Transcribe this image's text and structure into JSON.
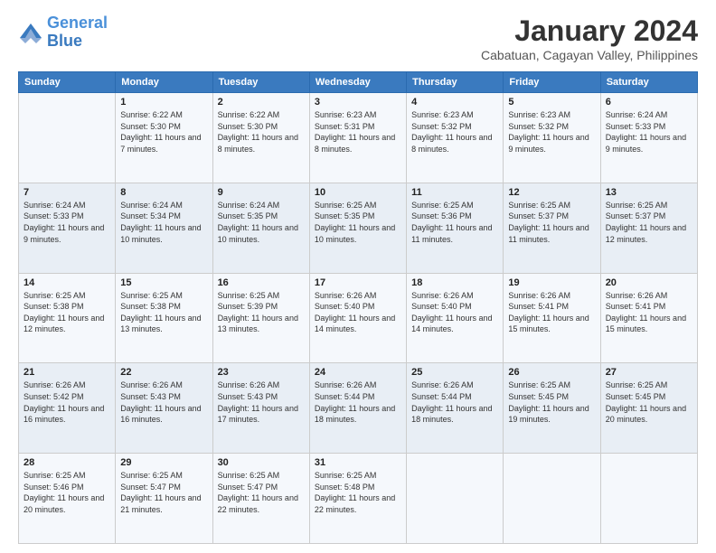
{
  "logo": {
    "line1": "General",
    "line2": "Blue"
  },
  "title": "January 2024",
  "subtitle": "Cabatuan, Cagayan Valley, Philippines",
  "days_of_week": [
    "Sunday",
    "Monday",
    "Tuesday",
    "Wednesday",
    "Thursday",
    "Friday",
    "Saturday"
  ],
  "weeks": [
    [
      {
        "num": "",
        "sunrise": "",
        "sunset": "",
        "daylight": ""
      },
      {
        "num": "1",
        "sunrise": "Sunrise: 6:22 AM",
        "sunset": "Sunset: 5:30 PM",
        "daylight": "Daylight: 11 hours and 7 minutes."
      },
      {
        "num": "2",
        "sunrise": "Sunrise: 6:22 AM",
        "sunset": "Sunset: 5:30 PM",
        "daylight": "Daylight: 11 hours and 8 minutes."
      },
      {
        "num": "3",
        "sunrise": "Sunrise: 6:23 AM",
        "sunset": "Sunset: 5:31 PM",
        "daylight": "Daylight: 11 hours and 8 minutes."
      },
      {
        "num": "4",
        "sunrise": "Sunrise: 6:23 AM",
        "sunset": "Sunset: 5:32 PM",
        "daylight": "Daylight: 11 hours and 8 minutes."
      },
      {
        "num": "5",
        "sunrise": "Sunrise: 6:23 AM",
        "sunset": "Sunset: 5:32 PM",
        "daylight": "Daylight: 11 hours and 9 minutes."
      },
      {
        "num": "6",
        "sunrise": "Sunrise: 6:24 AM",
        "sunset": "Sunset: 5:33 PM",
        "daylight": "Daylight: 11 hours and 9 minutes."
      }
    ],
    [
      {
        "num": "7",
        "sunrise": "Sunrise: 6:24 AM",
        "sunset": "Sunset: 5:33 PM",
        "daylight": "Daylight: 11 hours and 9 minutes."
      },
      {
        "num": "8",
        "sunrise": "Sunrise: 6:24 AM",
        "sunset": "Sunset: 5:34 PM",
        "daylight": "Daylight: 11 hours and 10 minutes."
      },
      {
        "num": "9",
        "sunrise": "Sunrise: 6:24 AM",
        "sunset": "Sunset: 5:35 PM",
        "daylight": "Daylight: 11 hours and 10 minutes."
      },
      {
        "num": "10",
        "sunrise": "Sunrise: 6:25 AM",
        "sunset": "Sunset: 5:35 PM",
        "daylight": "Daylight: 11 hours and 10 minutes."
      },
      {
        "num": "11",
        "sunrise": "Sunrise: 6:25 AM",
        "sunset": "Sunset: 5:36 PM",
        "daylight": "Daylight: 11 hours and 11 minutes."
      },
      {
        "num": "12",
        "sunrise": "Sunrise: 6:25 AM",
        "sunset": "Sunset: 5:37 PM",
        "daylight": "Daylight: 11 hours and 11 minutes."
      },
      {
        "num": "13",
        "sunrise": "Sunrise: 6:25 AM",
        "sunset": "Sunset: 5:37 PM",
        "daylight": "Daylight: 11 hours and 12 minutes."
      }
    ],
    [
      {
        "num": "14",
        "sunrise": "Sunrise: 6:25 AM",
        "sunset": "Sunset: 5:38 PM",
        "daylight": "Daylight: 11 hours and 12 minutes."
      },
      {
        "num": "15",
        "sunrise": "Sunrise: 6:25 AM",
        "sunset": "Sunset: 5:38 PM",
        "daylight": "Daylight: 11 hours and 13 minutes."
      },
      {
        "num": "16",
        "sunrise": "Sunrise: 6:25 AM",
        "sunset": "Sunset: 5:39 PM",
        "daylight": "Daylight: 11 hours and 13 minutes."
      },
      {
        "num": "17",
        "sunrise": "Sunrise: 6:26 AM",
        "sunset": "Sunset: 5:40 PM",
        "daylight": "Daylight: 11 hours and 14 minutes."
      },
      {
        "num": "18",
        "sunrise": "Sunrise: 6:26 AM",
        "sunset": "Sunset: 5:40 PM",
        "daylight": "Daylight: 11 hours and 14 minutes."
      },
      {
        "num": "19",
        "sunrise": "Sunrise: 6:26 AM",
        "sunset": "Sunset: 5:41 PM",
        "daylight": "Daylight: 11 hours and 15 minutes."
      },
      {
        "num": "20",
        "sunrise": "Sunrise: 6:26 AM",
        "sunset": "Sunset: 5:41 PM",
        "daylight": "Daylight: 11 hours and 15 minutes."
      }
    ],
    [
      {
        "num": "21",
        "sunrise": "Sunrise: 6:26 AM",
        "sunset": "Sunset: 5:42 PM",
        "daylight": "Daylight: 11 hours and 16 minutes."
      },
      {
        "num": "22",
        "sunrise": "Sunrise: 6:26 AM",
        "sunset": "Sunset: 5:43 PM",
        "daylight": "Daylight: 11 hours and 16 minutes."
      },
      {
        "num": "23",
        "sunrise": "Sunrise: 6:26 AM",
        "sunset": "Sunset: 5:43 PM",
        "daylight": "Daylight: 11 hours and 17 minutes."
      },
      {
        "num": "24",
        "sunrise": "Sunrise: 6:26 AM",
        "sunset": "Sunset: 5:44 PM",
        "daylight": "Daylight: 11 hours and 18 minutes."
      },
      {
        "num": "25",
        "sunrise": "Sunrise: 6:26 AM",
        "sunset": "Sunset: 5:44 PM",
        "daylight": "Daylight: 11 hours and 18 minutes."
      },
      {
        "num": "26",
        "sunrise": "Sunrise: 6:25 AM",
        "sunset": "Sunset: 5:45 PM",
        "daylight": "Daylight: 11 hours and 19 minutes."
      },
      {
        "num": "27",
        "sunrise": "Sunrise: 6:25 AM",
        "sunset": "Sunset: 5:45 PM",
        "daylight": "Daylight: 11 hours and 20 minutes."
      }
    ],
    [
      {
        "num": "28",
        "sunrise": "Sunrise: 6:25 AM",
        "sunset": "Sunset: 5:46 PM",
        "daylight": "Daylight: 11 hours and 20 minutes."
      },
      {
        "num": "29",
        "sunrise": "Sunrise: 6:25 AM",
        "sunset": "Sunset: 5:47 PM",
        "daylight": "Daylight: 11 hours and 21 minutes."
      },
      {
        "num": "30",
        "sunrise": "Sunrise: 6:25 AM",
        "sunset": "Sunset: 5:47 PM",
        "daylight": "Daylight: 11 hours and 22 minutes."
      },
      {
        "num": "31",
        "sunrise": "Sunrise: 6:25 AM",
        "sunset": "Sunset: 5:48 PM",
        "daylight": "Daylight: 11 hours and 22 minutes."
      },
      {
        "num": "",
        "sunrise": "",
        "sunset": "",
        "daylight": ""
      },
      {
        "num": "",
        "sunrise": "",
        "sunset": "",
        "daylight": ""
      },
      {
        "num": "",
        "sunrise": "",
        "sunset": "",
        "daylight": ""
      }
    ]
  ]
}
